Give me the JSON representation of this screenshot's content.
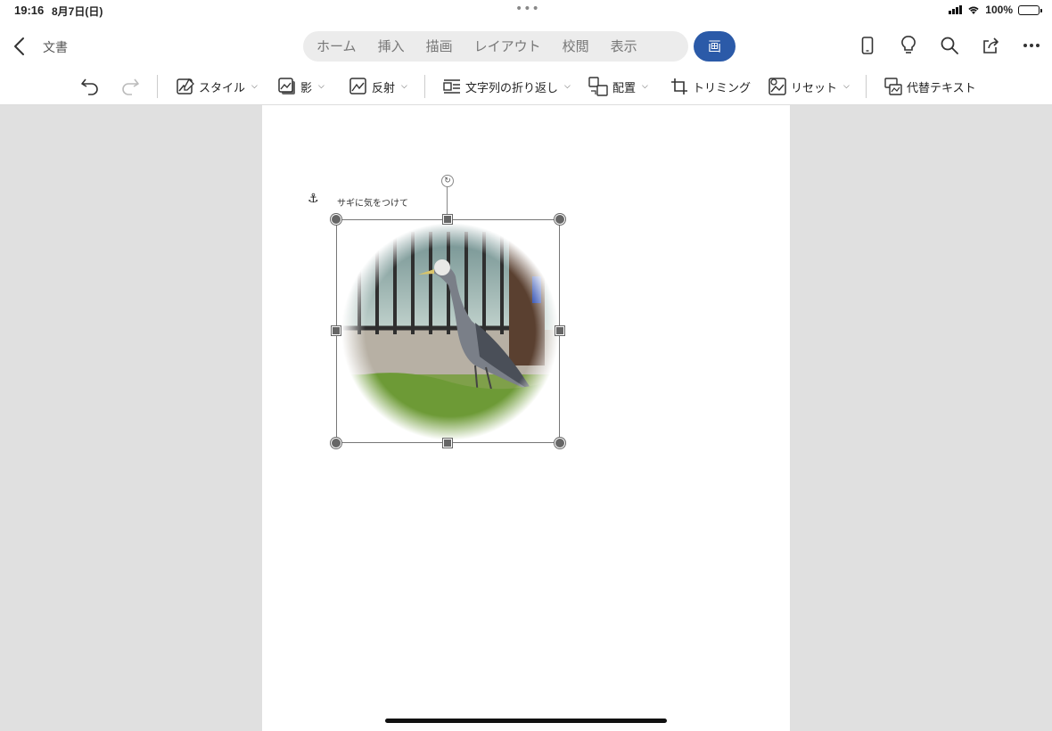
{
  "status": {
    "time": "19:16",
    "date": "8月7日(日)",
    "battery": "100%"
  },
  "header": {
    "doc_title": "文書",
    "tabs": [
      "ホーム",
      "挿入",
      "描画",
      "レイアウト",
      "校閲",
      "表示"
    ],
    "active_tab": "画像",
    "icons": [
      "phone-icon",
      "lightbulb-icon",
      "search-icon",
      "share-icon",
      "more-icon"
    ]
  },
  "ribbon": {
    "style": "スタイル",
    "shadow": "影",
    "reflection": "反射",
    "wrap": "文字列の折り返し",
    "arrange": "配置",
    "crop": "トリミング",
    "reset": "リセット",
    "alt_text": "代替テキスト"
  },
  "document": {
    "caption": "サギに気をつけて"
  },
  "colors": {
    "accent": "#2b5aa8",
    "canvas": "#e0e0e0",
    "battery": "#34c759"
  }
}
